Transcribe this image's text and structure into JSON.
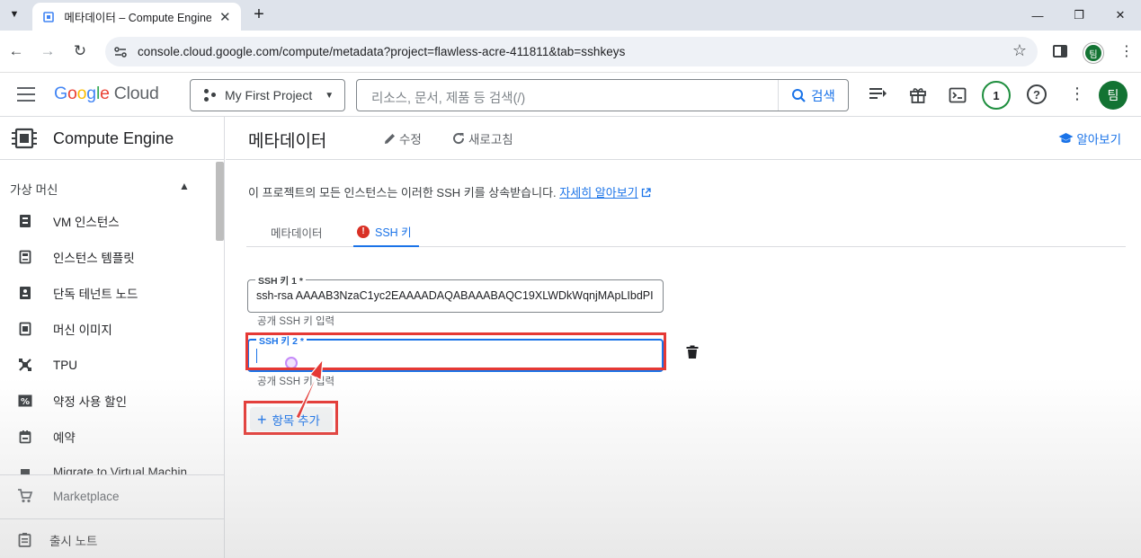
{
  "browser": {
    "tab_title": "메타데이터 – Compute Engine",
    "url": "console.cloud.google.com/compute/metadata?project=flawless-acre-411811&tab=sshkeys",
    "profile_initial": "팀"
  },
  "header": {
    "logo_google": [
      "G",
      "o",
      "o",
      "g",
      "l",
      "e"
    ],
    "logo_cloud": "Cloud",
    "project_name": "My First Project",
    "search_placeholder": "리소스, 문서, 제품 등 검색(/)",
    "search_button": "검색",
    "notification_count": "1",
    "help": "?",
    "avatar_initial": "팀"
  },
  "sidebar": {
    "product_name": "Compute Engine",
    "section_label": "가상 머신",
    "items": [
      {
        "label": "VM 인스턴스",
        "icon": "vm-icon"
      },
      {
        "label": "인스턴스 템플릿",
        "icon": "template-icon"
      },
      {
        "label": "단독 테넌트 노드",
        "icon": "tenant-node-icon"
      },
      {
        "label": "머신 이미지",
        "icon": "machine-image-icon"
      },
      {
        "label": "TPU",
        "icon": "tpu-icon"
      },
      {
        "label": "약정 사용 할인",
        "icon": "discount-icon"
      },
      {
        "label": "예약",
        "icon": "calendar-icon"
      },
      {
        "label": "Migrate to Virtual Machin",
        "icon": "migrate-icon"
      }
    ],
    "marketplace": "Marketplace",
    "release_notes": "출시 노트"
  },
  "main": {
    "page_title": "메타데이터",
    "edit_label": "수정",
    "refresh_label": "새로고침",
    "learn_label": "알아보기",
    "info_text": "이 프로젝트의 모든 인스턴스는 이러한 SSH 키를 상속받습니다.",
    "info_link": "자세히 알아보기",
    "tabs": [
      {
        "label": "메타데이터",
        "active": false
      },
      {
        "label": "SSH 키",
        "active": true
      }
    ],
    "ssh_keys": [
      {
        "label": "SSH 키 1 *",
        "value": "ssh-rsa AAAAB3NzaC1yc2EAAAADAQABAAABAQC19XLWDkWqnjMApLIbdPI",
        "helper": "공개 SSH 키 입력"
      },
      {
        "label": "SSH 키 2 *",
        "value": "",
        "helper": "공개 SSH 키 입력"
      }
    ],
    "add_item_label": "항목 추가"
  },
  "colors": {
    "accent": "#1a73e8",
    "annotation_red": "#e53935",
    "error": "#d93025",
    "avatar_green": "#137333"
  }
}
